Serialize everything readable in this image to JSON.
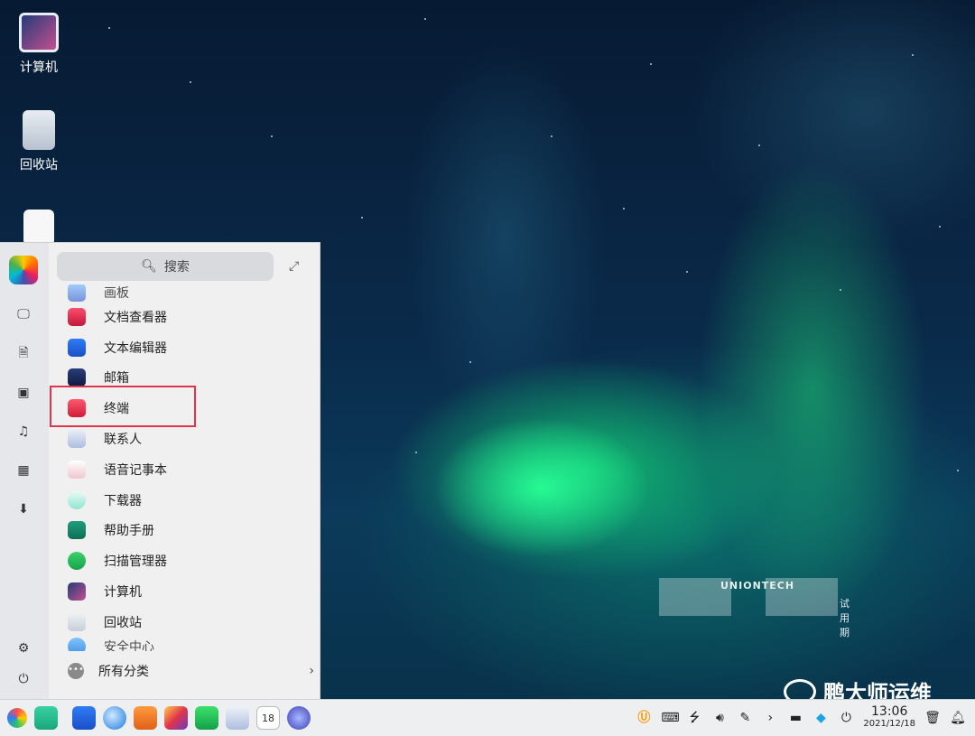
{
  "desktop": {
    "icons": [
      {
        "label": "计算机"
      },
      {
        "label": "回收站"
      },
      {
        "label": ""
      }
    ],
    "watermark": {
      "brand": "UNIONTECH",
      "trial": "试用期"
    },
    "overlay_brand": "鹏大师运维"
  },
  "launcher": {
    "search_placeholder": "搜索",
    "apps": [
      {
        "label": "画板"
      },
      {
        "label": "文档查看器"
      },
      {
        "label": "文本编辑器"
      },
      {
        "label": "邮箱"
      },
      {
        "label": "终端"
      },
      {
        "label": "联系人"
      },
      {
        "label": "语音记事本"
      },
      {
        "label": "下载器"
      },
      {
        "label": "帮助手册"
      },
      {
        "label": "扫描管理器"
      },
      {
        "label": "计算机"
      },
      {
        "label": "回收站"
      },
      {
        "label": "安全中心"
      }
    ],
    "all_categories": "所有分类"
  },
  "taskbar": {
    "clock": {
      "time": "13:06",
      "date": "2021/12/18"
    },
    "calendar_day": "18"
  },
  "colors": {
    "highlight": "#e0344a",
    "accent": "#1aa3e8"
  }
}
